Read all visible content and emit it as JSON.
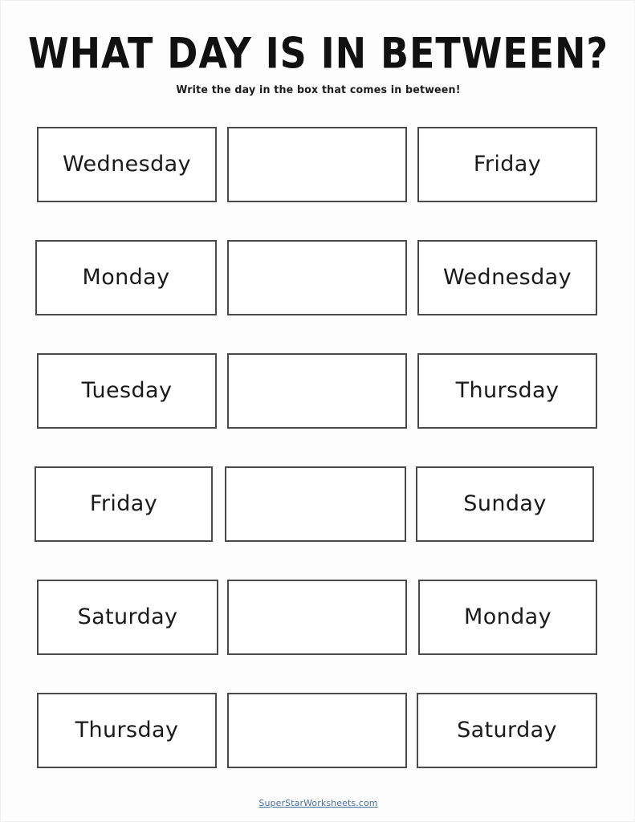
{
  "header": {
    "title": "WHAT DAY IS IN BETWEEN?",
    "subtitle": "Write the day in the box that comes in between!"
  },
  "colors": {
    "page_background": "#fdfdfd",
    "box_border": "#4a4a4a",
    "text": "#1a1a1a",
    "link": "#4a6fa5"
  },
  "rows": [
    {
      "left": "Wednesday",
      "middle": "",
      "right": "Friday"
    },
    {
      "left": "Monday",
      "middle": "",
      "right": "Wednesday"
    },
    {
      "left": "Tuesday",
      "middle": "",
      "right": "Thursday"
    },
    {
      "left": "Friday",
      "middle": "",
      "right": "Sunday"
    },
    {
      "left": "Saturday",
      "middle": "",
      "right": "Monday"
    },
    {
      "left": "Thursday",
      "middle": "",
      "right": "Saturday"
    }
  ],
  "footer": {
    "link_text": "SuperStarWorksheets.com"
  }
}
